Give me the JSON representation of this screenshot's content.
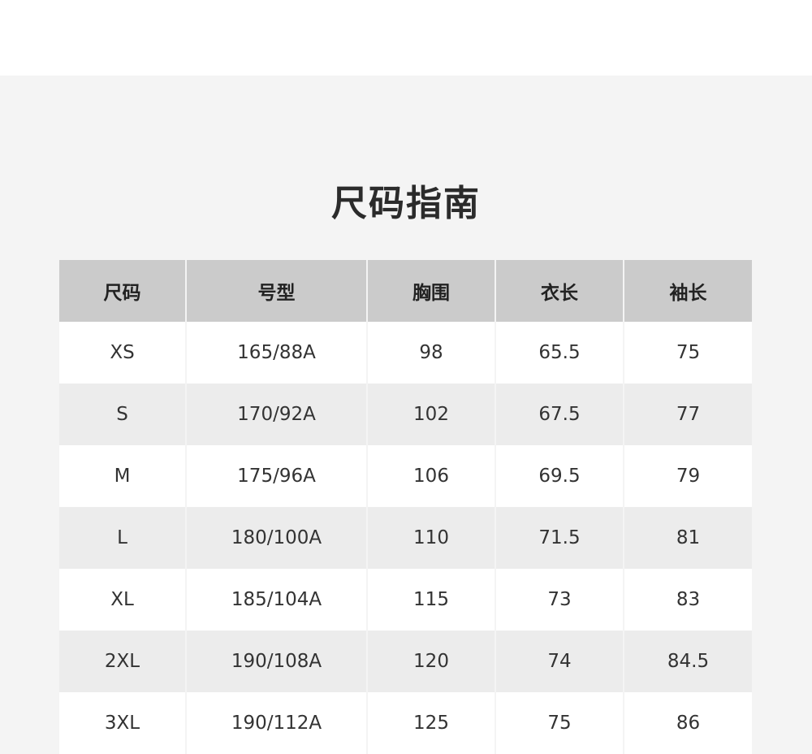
{
  "title": "尺码指南",
  "table": {
    "headers": [
      "尺码",
      "号型",
      "胸围",
      "衣长",
      "袖长"
    ],
    "rows": [
      [
        "XS",
        "165/88A",
        "98",
        "65.5",
        "75"
      ],
      [
        "S",
        "170/92A",
        "102",
        "67.5",
        "77"
      ],
      [
        "M",
        "175/96A",
        "106",
        "69.5",
        "79"
      ],
      [
        "L",
        "180/100A",
        "110",
        "71.5",
        "81"
      ],
      [
        "XL",
        "185/104A",
        "115",
        "73",
        "83"
      ],
      [
        "2XL",
        "190/108A",
        "120",
        "74",
        "84.5"
      ],
      [
        "3XL",
        "190/112A",
        "125",
        "75",
        "86"
      ]
    ]
  },
  "colors": {
    "panel_background": "#f4f4f4",
    "header_background": "#cbcbcb",
    "row_light": "#ffffff",
    "row_alt": "#ececec"
  }
}
